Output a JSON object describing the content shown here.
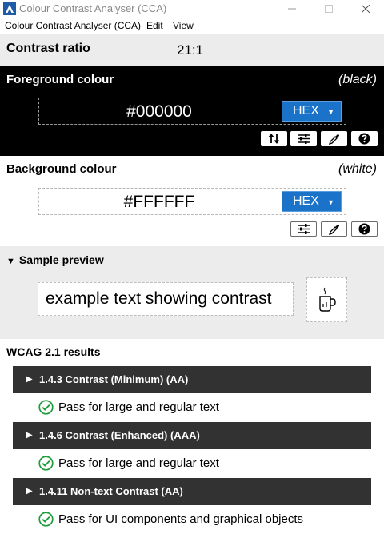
{
  "window": {
    "title": "Colour Contrast Analyser (CCA)"
  },
  "menu": [
    "Colour Contrast Analyser (CCA)",
    "Edit",
    "View"
  ],
  "contrast": {
    "label": "Contrast ratio",
    "value": "21:1"
  },
  "foreground": {
    "title": "Foreground colour",
    "name": "(black)",
    "hex": "#000000",
    "format": "HEX",
    "background_color": "#000000",
    "text_color": "#ffffff"
  },
  "background": {
    "title": "Background colour",
    "name": "(white)",
    "hex": "#FFFFFF",
    "format": "HEX",
    "background_color": "#ffffff",
    "text_color": "#000000"
  },
  "preview": {
    "title": "Sample preview",
    "sample_text": "example text showing contrast"
  },
  "results": {
    "title": "WCAG 2.1 results",
    "items": [
      {
        "criterion": "1.4.3 Contrast (Minimum) (AA)",
        "result": "Pass for large and regular text"
      },
      {
        "criterion": "1.4.6 Contrast (Enhanced) (AAA)",
        "result": "Pass for large and regular text"
      },
      {
        "criterion": "1.4.11 Non-text Contrast (AA)",
        "result": "Pass for UI components and graphical objects"
      }
    ]
  },
  "colors": {
    "accent": "#1a73c9",
    "pass": "#1e9e3a",
    "section_grey": "#ececec",
    "result_bar": "#323232"
  }
}
